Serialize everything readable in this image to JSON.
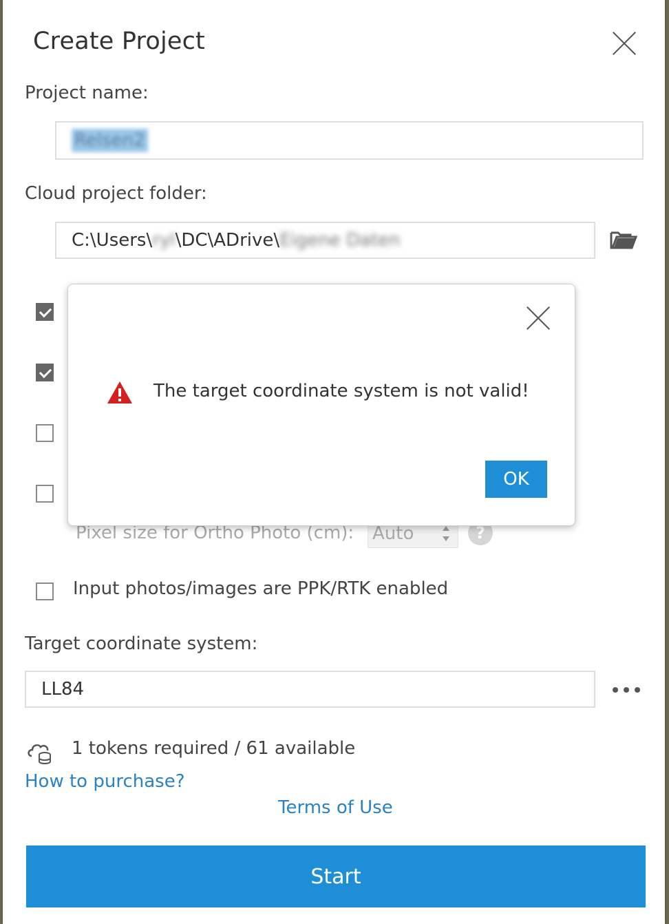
{
  "dialog": {
    "title": "Create Project"
  },
  "project_name": {
    "label": "Project name:",
    "value": "Relsen2"
  },
  "cloud_folder": {
    "label": "Cloud project folder:",
    "path_prefix": "C:\\Users\\",
    "path_user": "ryl",
    "path_middle": "\\DC\\ADrive\\",
    "path_tail": "Eigene Daten"
  },
  "checkboxes": [
    {
      "checked": true
    },
    {
      "checked": true
    },
    {
      "checked": false
    },
    {
      "checked": false
    }
  ],
  "pixel_size": {
    "label": "Pixel size for Ortho Photo (cm):",
    "value": "Auto"
  },
  "ppk": {
    "label": "Input photos/images are PPK/RTK enabled",
    "checked": false
  },
  "target_cs": {
    "label": "Target coordinate system:",
    "value": "LL84"
  },
  "tokens": {
    "text": "1 tokens required / 61 available"
  },
  "links": {
    "purchase": "How to purchase?",
    "terms": "Terms of Use"
  },
  "start_label": "Start",
  "alert": {
    "message": "The target coordinate system is not valid!",
    "ok_label": "OK"
  },
  "colors": {
    "accent": "#1e8fd6",
    "warning": "#d42020"
  }
}
